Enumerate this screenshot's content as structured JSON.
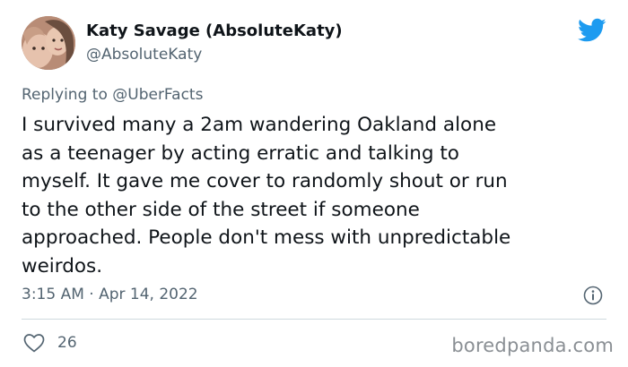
{
  "author": {
    "display_name": "Katy Savage (AbsoluteKaty)",
    "handle": "@AbsoluteKaty"
  },
  "reply": {
    "prefix": "Replying to ",
    "mention": "@UberFacts"
  },
  "tweet": {
    "text": "I survived many a 2am wandering Oakland alone\nas a teenager by acting erratic and talking to\nmyself. It gave me cover to randomly shout or run\nto the other side of the street if someone\napproached. People don't mess with unpredictable\nweirdos.",
    "timestamp": "3:15 AM · Apr 14, 2022"
  },
  "engagement": {
    "likes": "26"
  },
  "watermark": "boredpanda.com",
  "icons": {
    "brand": "twitter-bird-icon",
    "info": "info-icon",
    "like": "heart-icon"
  },
  "colors": {
    "twitter_blue": "#1d9bf0",
    "secondary_text": "#536471",
    "primary_text": "#0f1419",
    "divider": "#cfd9de"
  }
}
